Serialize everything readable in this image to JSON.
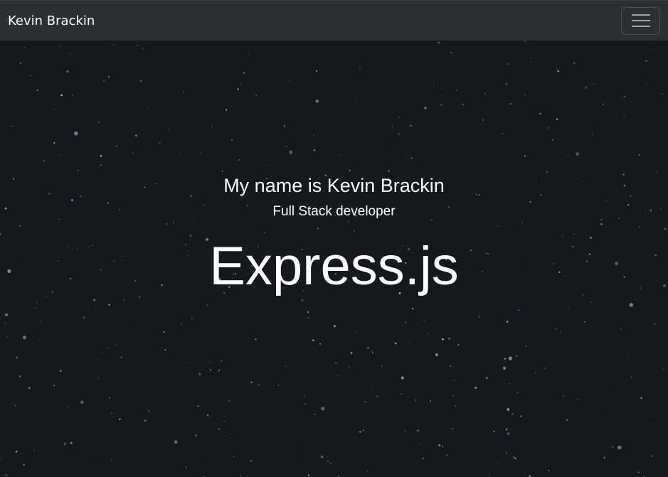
{
  "navbar": {
    "brand": "Kevin Brackin",
    "toggler_icon": "hamburger-menu-icon"
  },
  "hero": {
    "name_line": "My name is Kevin Brackin",
    "role_line": "Full Stack developer",
    "tech_line": "Express.js"
  },
  "colors": {
    "navbar_bg": "#2b3035",
    "page_bg": "#15181d",
    "text": "#ffffff"
  }
}
